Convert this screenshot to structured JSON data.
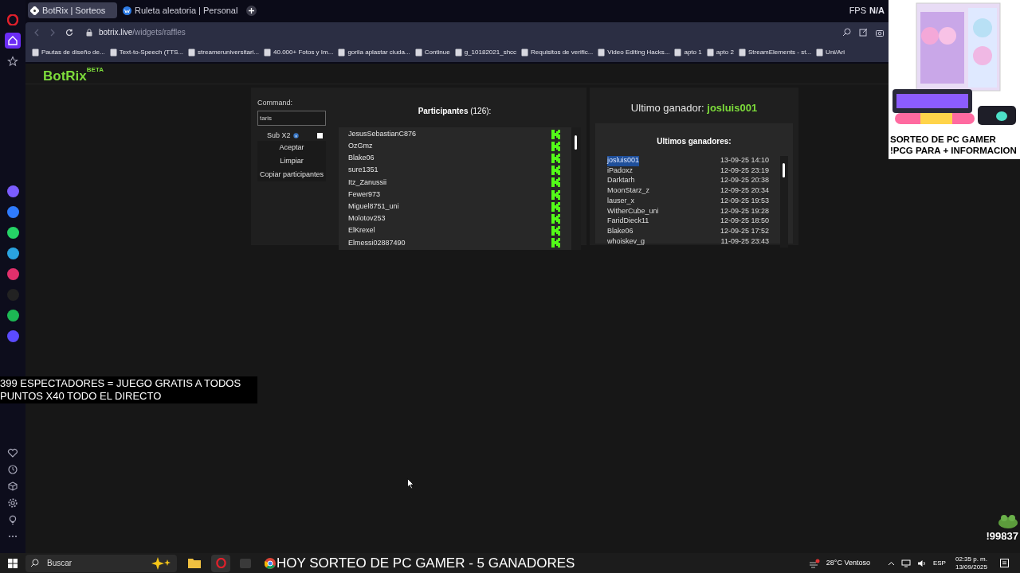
{
  "browser": {
    "tabs": [
      {
        "title": "BotRix | Sorteos",
        "selected": true
      },
      {
        "title": "Ruleta aleatoria | Personal",
        "selected": false
      }
    ],
    "address": {
      "domain": "botrix.live",
      "path": "/widgets/raffles"
    },
    "fps": {
      "label": "FPS",
      "value": "N/A"
    },
    "bookmarks": [
      "Pautas de diseño de...",
      "Text-to-Speech (TTS...",
      "streameruniversitari...",
      "40.000+ Fotos y Im...",
      "gorila aplastar ciuda...",
      "Continue",
      "g_10182021_shcc",
      "Requisitos de verific...",
      "Video Editing Hacks...",
      "apto 1",
      "apto 2",
      "StreamElements - st...",
      "Uni/Ari"
    ]
  },
  "sidebar": {
    "top": [
      {
        "selected": false
      },
      {
        "selected": true
      },
      {
        "selected": false
      }
    ]
  },
  "botrix": {
    "logo": "BotRix",
    "badge": "BETA"
  },
  "raffle": {
    "command_label": "Command:",
    "command_value": "taris",
    "sub_label": "Sub X2",
    "sub_checked": false,
    "buttons": [
      "Aceptar",
      "Limpiar",
      "Copiar participantes"
    ],
    "participants_title": "Participantes",
    "participants_count": "(126):",
    "participants": [
      "JesusSebastianC876",
      "OzGmz",
      "Blake06",
      "sure1351",
      "Itz_Zanussii",
      "Fewer973",
      "Miguel8751_uni",
      "Molotov253",
      "ElKrexel",
      "Elmessi02887490"
    ],
    "winner_label": "Ultimo ganador:",
    "winner_name": "josluis001",
    "winners_title": "Ultimos ganadores:",
    "winners": [
      {
        "name": "josluis001",
        "date": "13-09-25 14:10",
        "selected": true
      },
      {
        "name": "iPadoxz",
        "date": "12-09-25 23:19",
        "selected": false
      },
      {
        "name": "Darktarh",
        "date": "12-09-25 20:38",
        "selected": false
      },
      {
        "name": "MoonStarz_z",
        "date": "12-09-25 20:34",
        "selected": false
      },
      {
        "name": "lauser_x",
        "date": "12-09-25 19:53",
        "selected": false
      },
      {
        "name": "WitherCube_uni",
        "date": "12-09-25 19:28",
        "selected": false
      },
      {
        "name": "FaridDieck11",
        "date": "12-09-25 18:50",
        "selected": false
      },
      {
        "name": "Blake06",
        "date": "12-09-25 17:52",
        "selected": false
      },
      {
        "name": "whoiskev_g",
        "date": "11-09-25 23:43",
        "selected": false
      }
    ]
  },
  "overlays": {
    "spectators": [
      "399 ESPECTADORES = JUEGO GRATIS A TODOS",
      "PUNTOS X40 TODO EL DIRECTO"
    ],
    "promo": [
      "SORTEO DE PC GAMER",
      "!PCG PARA + INFORMACION"
    ],
    "banner": "HOY SORTEO DE PC GAMER - 5 GANADORES",
    "counter": "!99837"
  },
  "taskbar": {
    "search_placeholder": "Buscar",
    "weather": "28°C Ventoso",
    "language": "ESP",
    "time": "02:35 p. m.",
    "date": "13/09/2025"
  }
}
